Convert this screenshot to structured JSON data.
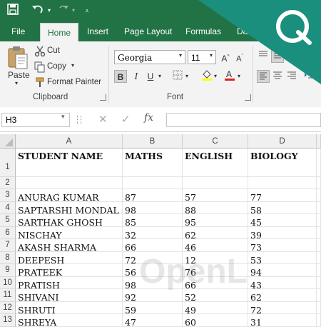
{
  "quick_access": {
    "save": "save-icon",
    "undo": "undo-icon",
    "redo": "redo-icon",
    "customize": "customize-icon"
  },
  "tabs": [
    "File",
    "Home",
    "Insert",
    "Page Layout",
    "Formulas",
    "Data"
  ],
  "clipboard": {
    "paste": "Paste",
    "cut": "Cut",
    "copy": "Copy",
    "format_painter": "Format Painter",
    "group": "Clipboard"
  },
  "font": {
    "name": "Georgia",
    "size": "11",
    "group": "Font"
  },
  "namebox": "H3",
  "formula_icons": {
    "cancel": "cancel-icon",
    "enter": "enter-icon",
    "fx": "fx"
  },
  "columns": [
    "A",
    "B",
    "C",
    "D"
  ],
  "rows": [
    "1",
    "2",
    "3",
    "4",
    "5",
    "6",
    "7",
    "8",
    "9",
    "10",
    "11",
    "12",
    "13"
  ],
  "table": {
    "headers": [
      "STUDENT NAME",
      "MATHS",
      "ENGLISH",
      "BIOLOGY"
    ],
    "records": [
      [
        "ANURAG KUMAR",
        "87",
        "57",
        "77"
      ],
      [
        "SAPTARSHI MONDAL",
        "98",
        "88",
        "58"
      ],
      [
        "SARTHAK GHOSH",
        "85",
        "95",
        "45"
      ],
      [
        "NISCHAY",
        "32",
        "62",
        "39"
      ],
      [
        "AKASH SHARMA",
        "66",
        "46",
        "73"
      ],
      [
        "DEEPESH",
        "72",
        "12",
        "53"
      ],
      [
        "PRATEEK",
        "56",
        "76",
        "94"
      ],
      [
        "PRATISH",
        "98",
        "66",
        "43"
      ],
      [
        "SHIVANI",
        "92",
        "52",
        "62"
      ],
      [
        "SHRUTI",
        "59",
        "49",
        "72"
      ],
      [
        "SHREYA",
        "47",
        "60",
        "31"
      ]
    ]
  },
  "colors": {
    "excel_green": "#217346",
    "logo_teal": "#1a8f7e"
  }
}
